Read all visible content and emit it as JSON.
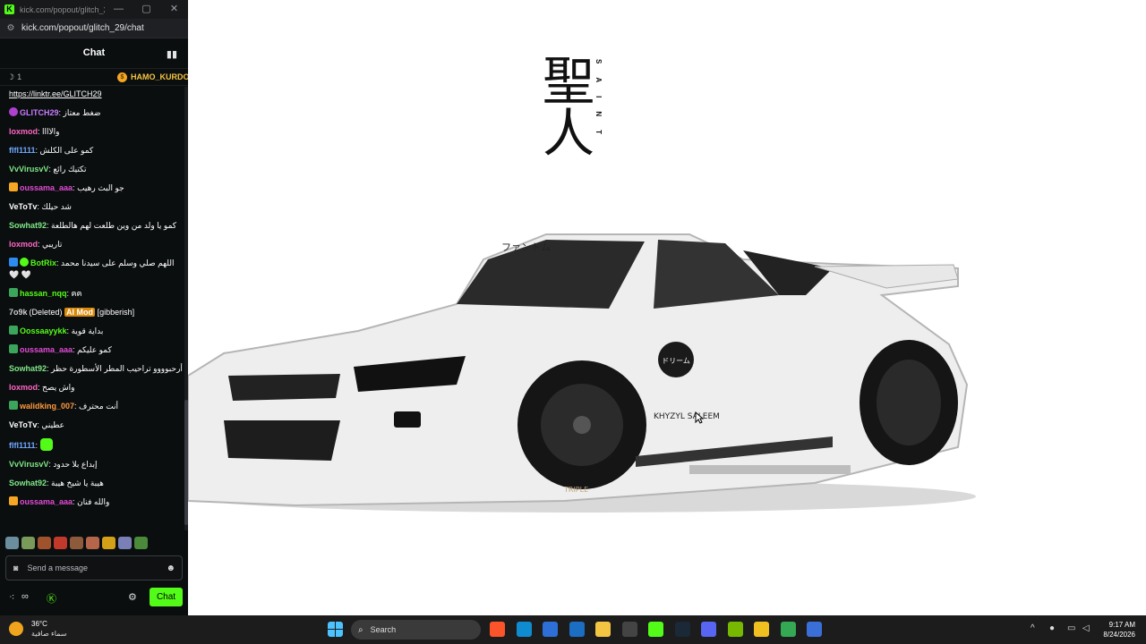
{
  "window": {
    "title": "kick.com/popout/glitch_29...",
    "controls": {
      "minimize": "—",
      "maximize": "▢",
      "close": "✕"
    }
  },
  "address": {
    "url": "kick.com/popout/glitch_29/chat"
  },
  "chat_header": {
    "title": "Chat"
  },
  "pinned": {
    "gift_count": "1",
    "gifter": "HAMO_KURDO"
  },
  "messages": [
    {
      "user": "GLITCH29",
      "color": "#c77dff",
      "badges": [
        "gift"
      ],
      "text": "ضغط معتاز"
    },
    {
      "user": "loxmod",
      "color": "#ff66c4",
      "badges": [],
      "text": "والاااا"
    },
    {
      "user": "flfl1111",
      "color": "#6fa8ff",
      "badges": [],
      "text": "كمو على الكلش"
    },
    {
      "user": "VvVirusvV",
      "color": "#7ee787",
      "badges": [],
      "text": "تكتيك رائع"
    },
    {
      "user": "oussama_aaa",
      "color": "#e24bd6",
      "badges": [
        "sub"
      ],
      "text": "جو البث رهيب"
    },
    {
      "user": "VeToTv",
      "color": "#ffffff",
      "badges": [],
      "text": "شد حيلك"
    },
    {
      "user": "Sowhat92",
      "color": "#7ee787",
      "badges": [],
      "text": "كمو يا ولد من وين طلعت لهم هالطلعة"
    },
    {
      "user": "loxmod",
      "color": "#ff66c4",
      "badges": [],
      "text": "تاريبي"
    },
    {
      "user": "BotRix",
      "color": "#53fc18",
      "badges": [
        "vip",
        "ver"
      ],
      "text": "اللهم صلي وسلم على سيدنا محمد 🤍 🤍"
    },
    {
      "user": "hassan_nqq",
      "color": "#53fc18",
      "badges": [
        "mod"
      ],
      "text": "ฅฅ"
    },
    {
      "user": "7o9k",
      "color": "#cfcfcf",
      "badges": [],
      "text": "[gibberish]",
      "deleted": "(Deleted)",
      "ai_mod": "AI Mod"
    },
    {
      "user": "Oossaayykk",
      "color": "#53fc18",
      "badges": [
        "mod"
      ],
      "text": "بداية قوية"
    },
    {
      "user": "oussama_aaa",
      "color": "#e24bd6",
      "badges": [
        "mod"
      ],
      "text": "كمو عليكم"
    },
    {
      "user": "Sowhat92",
      "color": "#7ee787",
      "badges": [],
      "text": "أرحبوووو تراحيب المطر الأسطورة حظر"
    },
    {
      "user": "loxmod",
      "color": "#ff66c4",
      "badges": [],
      "text": "واش يصح"
    },
    {
      "user": "walidking_007",
      "color": "#ff9b3d",
      "badges": [
        "mod"
      ],
      "text": "أنت محترف"
    },
    {
      "user": "VeToTv",
      "color": "#ffffff",
      "badges": [],
      "text": "عطيني"
    },
    {
      "user": "flfl1111",
      "color": "#6fa8ff",
      "badges": [],
      "text": "",
      "emote": true
    },
    {
      "user": "VvVirusvV",
      "color": "#7ee787",
      "badges": [],
      "text": "إبداع بلا حدود"
    },
    {
      "user": "Sowhat92",
      "color": "#7ee787",
      "badges": [],
      "text": "هيبة يا شيخ هيبة"
    },
    {
      "user": "oussama_aaa",
      "color": "#e24bd6",
      "badges": [
        "sub"
      ],
      "text": "والله فنان"
    }
  ],
  "top_partial": {
    "link": "https://linktr.ee/GLITCH29"
  },
  "emotes": [
    "#6b8e9f",
    "#7a9a5a",
    "#a0522d",
    "#c0392b",
    "#8e5a3c",
    "#b5654a",
    "#d4a017",
    "#7a7fb5",
    "#4a8a3a"
  ],
  "input": {
    "placeholder": "Send a message"
  },
  "footer": {
    "send_label": "Chat"
  },
  "stage": {
    "kanji": "聖人",
    "vertical_text": "SAINT",
    "car_brand": "ファントム",
    "door_logo": "ドリーム",
    "side_text": "KHYZYL SALEEM",
    "tire_text": "TRIPLE"
  },
  "taskbar": {
    "weather": {
      "temp": "36°C",
      "condition": "سماء صافية"
    },
    "search_label": "Search",
    "apps": [
      {
        "name": "brave",
        "color": "#fb542b"
      },
      {
        "name": "edge",
        "color": "#0f8ccf"
      },
      {
        "name": "store",
        "color": "#2d6fd6"
      },
      {
        "name": "outlook",
        "color": "#1b6ec2"
      },
      {
        "name": "explorer",
        "color": "#f4c542"
      },
      {
        "name": "github",
        "color": "#444444"
      },
      {
        "name": "kick",
        "color": "#53fc18"
      },
      {
        "name": "steam",
        "color": "#1b2838"
      },
      {
        "name": "discord",
        "color": "#5865f2"
      },
      {
        "name": "nvidia",
        "color": "#76b900"
      },
      {
        "name": "notes",
        "color": "#f0c020"
      },
      {
        "name": "chrome",
        "color": "#34a853"
      },
      {
        "name": "vpn",
        "color": "#3b6fd8"
      }
    ],
    "time": "9:17 AM",
    "date": "8/24/2026"
  }
}
